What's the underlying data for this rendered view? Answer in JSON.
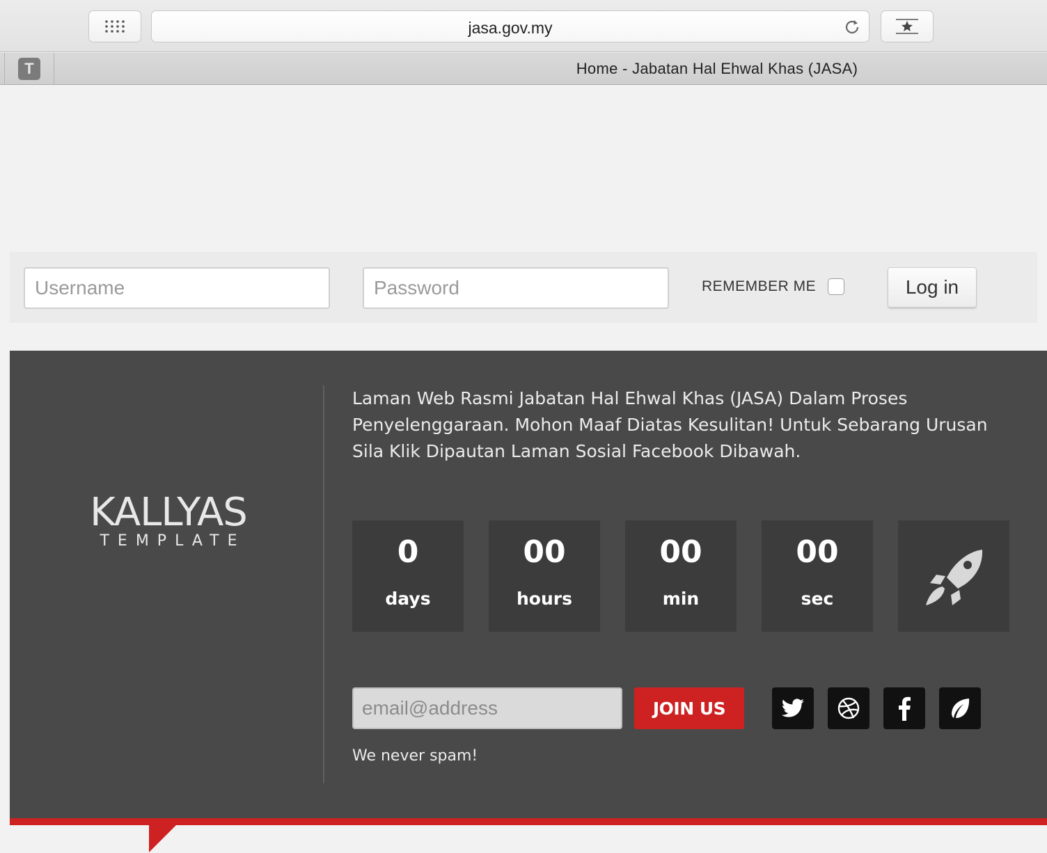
{
  "browser": {
    "url": "jasa.gov.my",
    "tab_title": "Home - Jabatan Hal Ehwal Khas (JASA)",
    "tab_favicon_letter": "T"
  },
  "login": {
    "username_placeholder": "Username",
    "password_placeholder": "Password",
    "remember_label": "REMEMBER ME",
    "login_label": "Log in"
  },
  "logo": {
    "main": "KALLYAS",
    "sub": "TEMPLATE"
  },
  "message": "Laman Web Rasmi Jabatan Hal Ehwal Khas (JASA) Dalam Proses Penyelenggaraan. Mohon Maaf Diatas Kesulitan! Untuk Sebarang Urusan Sila Klik Dipautan Laman Sosial Facebook Dibawah.",
  "countdown": [
    {
      "value": "0",
      "label": "days"
    },
    {
      "value": "00",
      "label": "hours"
    },
    {
      "value": "00",
      "label": "min"
    },
    {
      "value": "00",
      "label": "sec"
    }
  ],
  "newsletter": {
    "email_placeholder": "email@address",
    "join_label": "JOIN US",
    "note": "We never spam!"
  },
  "social": [
    "twitter-icon",
    "dribbble-icon",
    "facebook-icon",
    "vine-icon"
  ],
  "colors": {
    "accent_red": "#cd2122",
    "panel_bg": "#494949",
    "tile_bg": "#3c3c3c"
  }
}
